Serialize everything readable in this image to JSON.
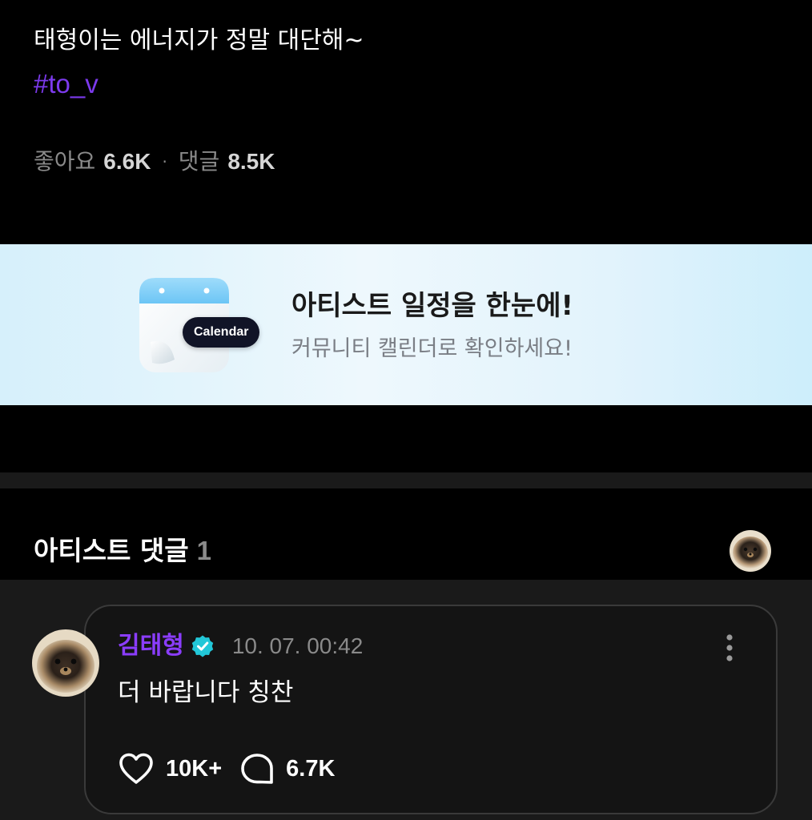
{
  "post": {
    "text": "태형이는 에너지가 정말 대단해~",
    "hashtag": "#to_v",
    "stats": {
      "likes_label": "좋아요",
      "likes_value": "6.6K",
      "separator": "·",
      "comments_label": "댓글",
      "comments_value": "8.5K"
    }
  },
  "banner": {
    "badge": "Calendar",
    "title": "아티스트 일정을 한눈에!",
    "subtitle": "커뮤니티 캘린더로 확인하세요!",
    "icon": "calendar-icon"
  },
  "artist_comments": {
    "title": "아티스트 댓글",
    "count": "1"
  },
  "comment": {
    "author": "김태형",
    "verified_icon": "verified-badge-icon",
    "timestamp": "10. 07. 00:42",
    "text": "더 바랍니다 칭찬",
    "likes": "10K+",
    "replies": "6.7K",
    "like_icon": "heart-icon",
    "reply_icon": "speech-bubble-icon",
    "more_icon": "more-vertical-icon"
  },
  "colors": {
    "accent_purple": "#8b3dff",
    "hashtag_purple": "#7c3aed",
    "verified_teal": "#22c7d8",
    "banner_bg": "#e6f6fd"
  }
}
